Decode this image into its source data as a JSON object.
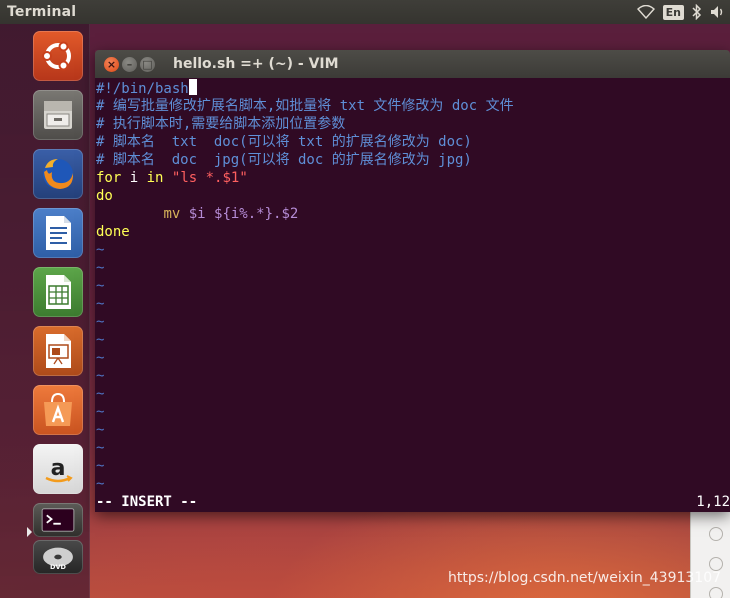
{
  "top_panel": {
    "app_title": "Terminal",
    "tray": {
      "network_icon": "wifi-icon",
      "language": "En",
      "bluetooth_icon": "bluetooth-icon",
      "volume_icon": "volume-icon"
    }
  },
  "launcher": {
    "items": [
      {
        "name": "ubuntu-dash-icon"
      },
      {
        "name": "files-icon"
      },
      {
        "name": "firefox-icon"
      },
      {
        "name": "libreoffice-writer-icon"
      },
      {
        "name": "libreoffice-calc-icon"
      },
      {
        "name": "libreoffice-impress-icon"
      },
      {
        "name": "software-center-icon"
      },
      {
        "name": "amazon-icon"
      },
      {
        "name": "terminal-icon"
      },
      {
        "name": "dvd-icon"
      }
    ]
  },
  "window": {
    "title": "hello.sh =+ (~) - VIM"
  },
  "editor": {
    "line1": "#!/bin/bash",
    "line2": "# 编写批量修改扩展名脚本,如批量将 txt 文件修改为 doc 文件",
    "line3": "# 执行脚本时,需要给脚本添加位置参数",
    "line4": "# 脚本名  txt  doc(可以将 txt 的扩展名修改为 doc)",
    "line5": "# 脚本名  doc  jpg(可以将 doc 的扩展名修改为 jpg)",
    "line6": {
      "kw_for": "for",
      "var_i": " i ",
      "kw_in": "in",
      "space": " ",
      "str": "\"ls *.$1\""
    },
    "line7": "do",
    "line8": {
      "indent": "        ",
      "cmd": "mv",
      "args": " $i ${i%.*}.$2"
    },
    "line9": "done",
    "tilde": "~",
    "mode": "-- INSERT --",
    "position": "1,12"
  },
  "watermark": "https://blog.csdn.net/weixin_43913107",
  "colors": {
    "terminal_bg": "#300a24",
    "comment": "#5f8fd7",
    "keyword": "#ffff55",
    "string": "#ff6060",
    "tilde": "#4f73c3"
  }
}
